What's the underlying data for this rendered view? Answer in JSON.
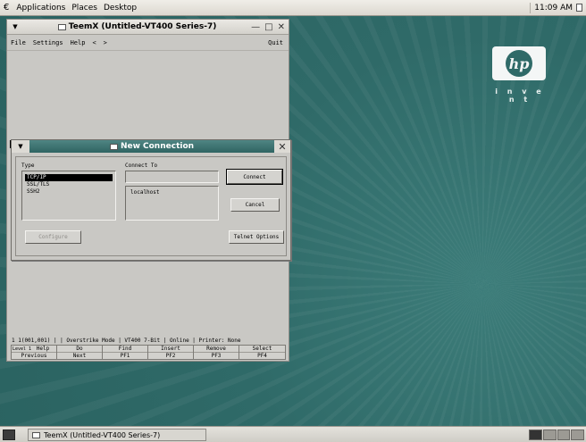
{
  "top_panel": {
    "menus": [
      "Applications",
      "Places",
      "Desktop"
    ],
    "clock": "11:09 AM"
  },
  "desktop": {
    "logo_text": "hp",
    "tagline": "i n v e n t"
  },
  "teemx_window": {
    "title": "TeemX (Untitled-VT400 Series-7)",
    "menu": {
      "file": "File",
      "settings": "Settings",
      "help": "Help",
      "back": "<",
      "forward": ">",
      "quit": "Quit"
    },
    "status_line": "1 1(001,001) |     | Overstrike Mode | VT400 7-Bit | Online | Printer: None",
    "function_keys": [
      {
        "top": "Level 1",
        "bottom": ""
      },
      {
        "top": "Help",
        "bottom": "Previous"
      },
      {
        "top": "Do",
        "bottom": "Next"
      },
      {
        "top": "Find",
        "bottom": "PF1"
      },
      {
        "top": "Insert",
        "bottom": "PF2"
      },
      {
        "top": "Remove",
        "bottom": "PF3"
      },
      {
        "top": "Select",
        "bottom": "PF4"
      }
    ]
  },
  "dialog": {
    "title": "New Connection",
    "type_label": "Type",
    "types": [
      "TCP/IP",
      "SSL/TLS",
      "SSH2"
    ],
    "selected_type": "TCP/IP",
    "connect_to_label": "Connect To",
    "connect_to_value": "",
    "hosts": [
      "localhost"
    ],
    "buttons": {
      "connect": "Connect",
      "cancel": "Cancel",
      "configure": "Configure",
      "telnet_options": "Telnet Options"
    }
  },
  "taskbar": {
    "task": "TeemX (Untitled-VT400 Series-7)"
  }
}
